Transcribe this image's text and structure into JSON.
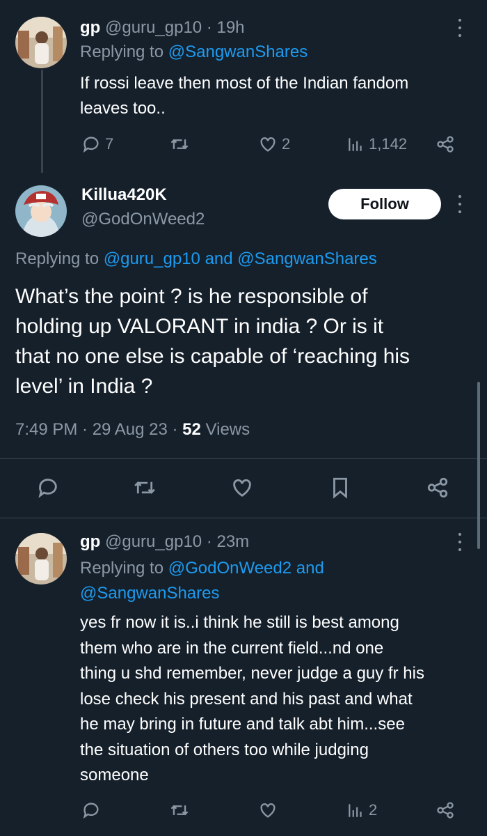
{
  "reply1": {
    "name": "gp",
    "handle": "@guru_gp10",
    "time": "· 19h",
    "replying_prefix": "Replying to",
    "replying_to": "@SangwanShares",
    "text_line1": "If rossi leave then most of the Indian fandom",
    "text_line2": "leaves too..",
    "replies": "7",
    "likes": "2",
    "views": "1,142"
  },
  "main": {
    "name": "Killua420K",
    "handle": "@GodOnWeed2",
    "follow_label": "Follow",
    "replying_prefix": "Replying to",
    "replying_to1": "@guru_gp10",
    "replying_and": "and",
    "replying_to2": "@SangwanShares",
    "text_line1": "What’s the point ? is he responsible of",
    "text_line2": "holding up VALORANT in india ? Or is it",
    "text_line3": "that no one else is capable of ‘reaching his",
    "text_line4": "level’ in India ?",
    "time": "7:49 PM · 29 Aug 23 ·",
    "views_count": "52",
    "views_label": "Views"
  },
  "reply2": {
    "name": "gp",
    "handle": "@guru_gp10",
    "time": "· 23m",
    "replying_prefix": "Replying to",
    "replying_to1": "@GodOnWeed2",
    "replying_and": "and",
    "replying_to2": "@SangwanShares",
    "lines": [
      "yes fr now it is..i think he still is best among",
      "them who are in the current field...nd one",
      "thing u shd remember, never judge a guy fr his",
      "lose check his present and his past and what",
      "he may bring in future and talk abt him...see",
      "the situation of others too while judging",
      "someone"
    ],
    "views": "2"
  },
  "icons": [
    "reply-icon",
    "retweet-icon",
    "like-icon",
    "views-icon",
    "share-icon",
    "bookmark-icon",
    "more-icon"
  ],
  "colors": {
    "background": "#15202b",
    "accent": "#1d9bf0",
    "muted": "#8b98a5",
    "divider": "#38444d"
  }
}
